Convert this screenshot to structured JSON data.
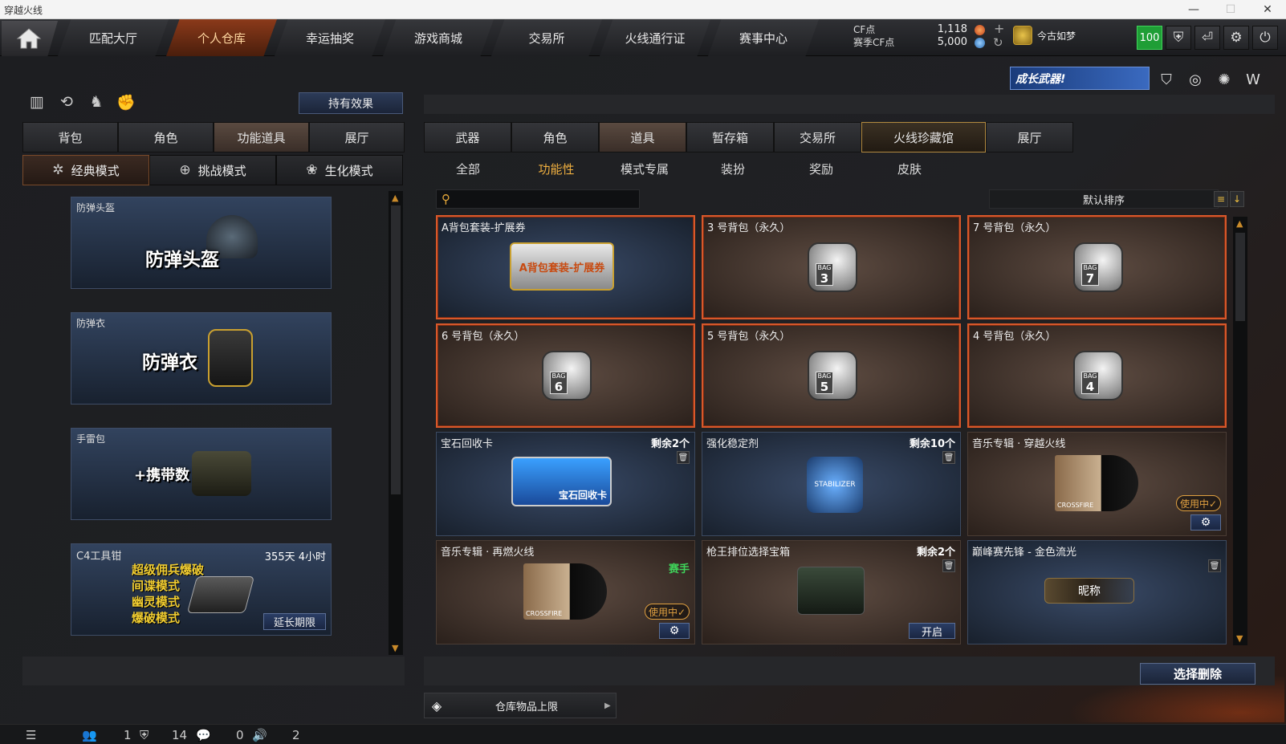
{
  "window": {
    "title": "穿越火线",
    "minimize": "—",
    "maximize": "☐",
    "close": "✕"
  },
  "nav": {
    "tabs": [
      "匹配大厅",
      "个人仓库",
      "幸运抽奖",
      "游戏商城",
      "交易所",
      "火线通行证",
      "赛事中心"
    ],
    "active_index": 1,
    "cf_label": "CF点",
    "season_cf_label": "赛季CF点",
    "cf_value": "1,118",
    "season_cf_value": "5,000",
    "plus": "+",
    "refresh": "↻",
    "username": "今古如梦",
    "level": "100",
    "icons": [
      "shield-icon",
      "exit-icon",
      "gear-icon",
      "power-icon"
    ]
  },
  "left": {
    "effect_button": "持有效果",
    "tabs": [
      "背包",
      "角色",
      "功能道具",
      "展厅"
    ],
    "active_tab": 2,
    "modes": [
      {
        "label": "经典模式",
        "icon": "✲"
      },
      {
        "label": "挑战模式",
        "icon": "⊕"
      },
      {
        "label": "生化模式",
        "icon": "❀"
      }
    ],
    "items": [
      {
        "name": "防弹头盔",
        "big": "防弹头盔"
      },
      {
        "name": "防弹衣",
        "big": "防弹衣"
      },
      {
        "name": "手雷包",
        "big": "+携带数"
      },
      {
        "name": "C4工具钳",
        "time": "355天 4小时",
        "lines": [
          "超级佣兵爆破",
          "间谍模式",
          "幽灵模式",
          "爆破模式"
        ],
        "extend": "延长期限"
      }
    ]
  },
  "right": {
    "banner": "成长武器!",
    "tabs": [
      "武器",
      "角色",
      "道具",
      "暂存箱",
      "交易所",
      "火线珍藏馆",
      "展厅"
    ],
    "active_tab": 2,
    "special_tab": 5,
    "subtabs": [
      "全部",
      "功能性",
      "模式专属",
      "装扮",
      "奖励",
      "皮肤"
    ],
    "active_subtab": 1,
    "search_placeholder": "",
    "sort_label": "默认排序",
    "cards": [
      {
        "name": "A背包套装-扩展券",
        "style": "blue",
        "sel": true,
        "art": "A背包套装-扩展券"
      },
      {
        "name": "3 号背包（永久）",
        "style": "brown",
        "sel": true,
        "bag": "3"
      },
      {
        "name": "7 号背包（永久）",
        "style": "brown",
        "sel": true,
        "bag": "7"
      },
      {
        "name": "6 号背包（永久）",
        "style": "brown",
        "sel": true,
        "bag": "6"
      },
      {
        "name": "5 号背包（永久）",
        "style": "brown",
        "sel": true,
        "bag": "5"
      },
      {
        "name": "4 号背包（永久）",
        "style": "brown",
        "sel": true,
        "bag": "4"
      },
      {
        "name": "宝石回收卡",
        "style": "blue",
        "left": "剩余2个",
        "trash": true,
        "art": "宝石回收卡"
      },
      {
        "name": "强化稳定剂",
        "style": "blue",
        "left": "剩余10个",
        "trash": true,
        "art": "STABILIZER"
      },
      {
        "name": "音乐专辑 · 穿越火线",
        "style": "brown",
        "inuse": "使用中✓",
        "gear": true,
        "art": "CROSSFIRE"
      },
      {
        "name": "音乐专辑 · 再燃火线",
        "style": "brown",
        "tag": "赛手",
        "inuse": "使用中✓",
        "gear": true,
        "art": "CROSSFIRE"
      },
      {
        "name": "枪王排位选择宝箱",
        "style": "brown",
        "left": "剩余2个",
        "trash": true,
        "open": "开启"
      },
      {
        "name": "巅峰赛先锋 - 金色流光",
        "style": "blue",
        "trash": true,
        "art": "昵称"
      }
    ],
    "delete_button": "选择删除",
    "storage_label": "仓库物品上限"
  },
  "statusbar": {
    "count1": "1",
    "count2": "14",
    "count3": "0",
    "count4": "2"
  },
  "colors": {
    "accent": "#d8582a",
    "gold": "#f0b040",
    "green": "#1f9e36"
  }
}
